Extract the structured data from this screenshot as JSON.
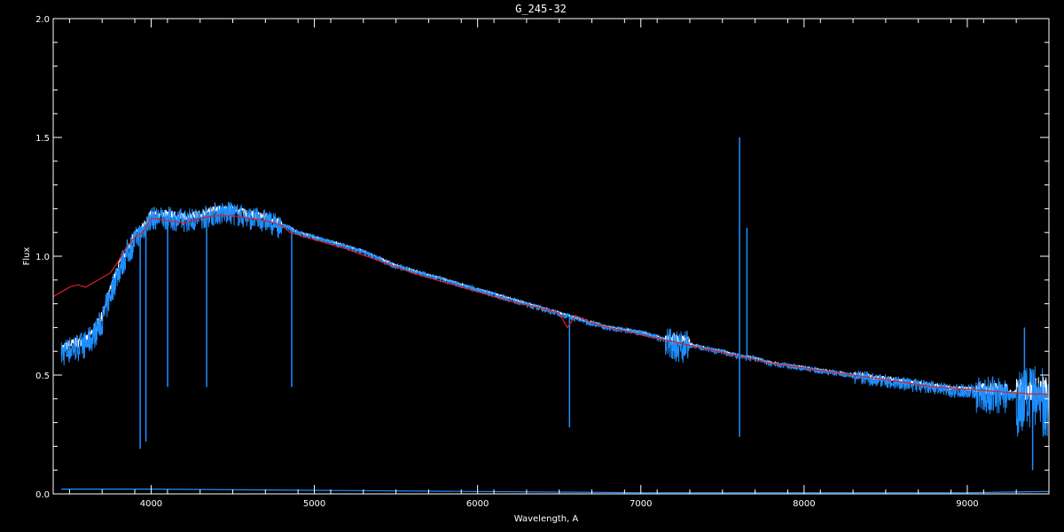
{
  "chart_data": {
    "type": "line",
    "title": "G_245-32",
    "xlabel": "Wavelength, A",
    "ylabel": "Flux",
    "xlim": [
      3400,
      9500
    ],
    "ylim": [
      0.0,
      2.0
    ],
    "x_ticks": [
      4000,
      5000,
      6000,
      7000,
      8000,
      9000
    ],
    "y_ticks": [
      0.0,
      0.5,
      1.0,
      1.5,
      2.0
    ],
    "x_tick_labels": [
      "4000",
      "5000",
      "6000",
      "7000",
      "8000",
      "9000"
    ],
    "y_tick_labels": [
      "0.0",
      "0.5",
      "1.0",
      "1.5",
      "2.0"
    ],
    "grid": false,
    "colors": {
      "background": "#000000",
      "axes": "#ffffff",
      "observed_white": "#ffffff",
      "observed_blue": "#1e8fff",
      "model": "#d8202a",
      "error": "#1e8fff"
    },
    "series": [
      {
        "role": "observed",
        "x": [
          3450,
          3500,
          3550,
          3600,
          3650,
          3700,
          3750,
          3800,
          3850,
          3900,
          3950,
          4000,
          4100,
          4200,
          4300,
          4400,
          4500,
          4600,
          4700,
          4800,
          4850,
          4900,
          5000,
          5100,
          5200,
          5300,
          5400,
          5500,
          5600,
          5700,
          5800,
          5900,
          6000,
          6100,
          6200,
          6300,
          6400,
          6500,
          6550,
          6600,
          6700,
          6800,
          6900,
          7000,
          7100,
          7200,
          7300,
          7400,
          7500,
          7600,
          7700,
          7800,
          7900,
          8000,
          8100,
          8200,
          8300,
          8400,
          8500,
          8600,
          8700,
          8800,
          8900,
          9000,
          9100,
          9200,
          9300,
          9400,
          9500
        ],
        "y": [
          0.6,
          0.62,
          0.63,
          0.64,
          0.68,
          0.74,
          0.85,
          0.95,
          1.02,
          1.08,
          1.12,
          1.17,
          1.17,
          1.16,
          1.17,
          1.19,
          1.19,
          1.17,
          1.16,
          1.13,
          1.12,
          1.1,
          1.08,
          1.06,
          1.04,
          1.02,
          0.99,
          0.96,
          0.94,
          0.92,
          0.9,
          0.88,
          0.86,
          0.84,
          0.82,
          0.8,
          0.78,
          0.76,
          0.75,
          0.74,
          0.72,
          0.7,
          0.69,
          0.68,
          0.66,
          0.64,
          0.63,
          0.61,
          0.6,
          0.58,
          0.57,
          0.55,
          0.54,
          0.53,
          0.52,
          0.51,
          0.5,
          0.49,
          0.48,
          0.47,
          0.46,
          0.45,
          0.44,
          0.44,
          0.43,
          0.43,
          0.42,
          0.42,
          0.42
        ]
      },
      {
        "role": "model",
        "x": [
          3400,
          3450,
          3500,
          3550,
          3600,
          3650,
          3700,
          3750,
          3800,
          3850,
          3900,
          3950,
          4000,
          4100,
          4200,
          4300,
          4400,
          4500,
          4600,
          4700,
          4800,
          4850,
          4900,
          5000,
          5200,
          5400,
          5600,
          5800,
          6000,
          6200,
          6400,
          6500,
          6550,
          6600,
          6700,
          6800,
          7000,
          7200,
          7400,
          7600,
          7800,
          8000,
          8200,
          8400,
          8600,
          8800,
          9000,
          9200,
          9400,
          9500
        ],
        "y": [
          0.83,
          0.85,
          0.87,
          0.88,
          0.87,
          0.89,
          0.91,
          0.93,
          0.98,
          1.04,
          1.08,
          1.1,
          1.16,
          1.15,
          1.14,
          1.16,
          1.17,
          1.17,
          1.16,
          1.15,
          1.13,
          1.1,
          1.09,
          1.07,
          1.03,
          0.98,
          0.93,
          0.89,
          0.85,
          0.81,
          0.78,
          0.76,
          0.7,
          0.75,
          0.72,
          0.7,
          0.67,
          0.64,
          0.61,
          0.58,
          0.55,
          0.53,
          0.51,
          0.49,
          0.47,
          0.45,
          0.44,
          0.43,
          0.42,
          0.42
        ]
      },
      {
        "role": "error",
        "x": [
          3450,
          4000,
          5000,
          6000,
          7000,
          8000,
          9000,
          9500
        ],
        "y": [
          0.02,
          0.02,
          0.015,
          0.01,
          0.005,
          0.005,
          0.005,
          0.01
        ]
      }
    ],
    "features": [
      {
        "x": 3933,
        "y": 0.19
      },
      {
        "x": 3968,
        "y": 0.22
      },
      {
        "x": 4101,
        "y": 0.45
      },
      {
        "x": 4340,
        "y": 0.45
      },
      {
        "x": 4861,
        "y": 0.45
      },
      {
        "x": 6563,
        "y": 0.28
      },
      {
        "x": 7605,
        "y": 1.5
      },
      {
        "x": 7605,
        "y": 0.24
      },
      {
        "x": 7650,
        "y": 1.12
      },
      {
        "x": 9350,
        "y": 0.7
      },
      {
        "x": 9400,
        "y": 0.1
      }
    ]
  }
}
